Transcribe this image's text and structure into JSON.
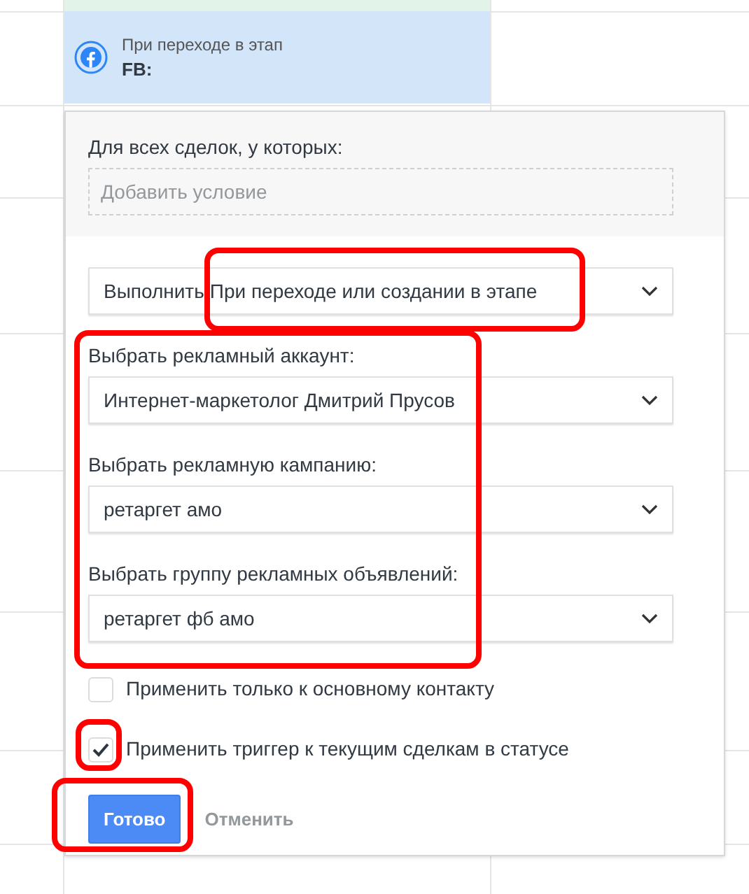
{
  "stage_card": {
    "caption": "При переходе в этап",
    "name": "FB:"
  },
  "popup": {
    "condition_label": "Для всех сделок, у которых:",
    "condition_placeholder": "Добавить условие",
    "execute": {
      "label": "Выполнить",
      "value": "При переходе или создании в этапе"
    },
    "selects": [
      {
        "label": "Выбрать рекламный аккаунт:",
        "value": "Интернет-маркетолог Дмитрий Прусов"
      },
      {
        "label": "Выбрать рекламную кампанию:",
        "value": "ретаргет амо"
      },
      {
        "label": "Выбрать группу рекламных объявлений:",
        "value": "ретаргет фб амо"
      }
    ],
    "checkboxes": [
      {
        "label": "Применить только к основному контакту",
        "checked": false
      },
      {
        "label": "Применить триггер к текущим сделкам в статусе",
        "checked": true
      }
    ],
    "buttons": [
      {
        "kind": "primary",
        "label": "Готово"
      },
      {
        "kind": "link",
        "label": "Отменить"
      }
    ]
  }
}
